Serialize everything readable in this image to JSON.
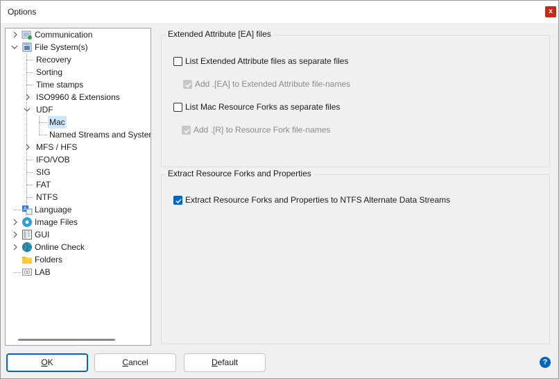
{
  "window": {
    "title": "Options",
    "close_glyph": "x"
  },
  "tree": {
    "items": [
      {
        "label": "Communication",
        "icon": "communication-icon",
        "expandable": true,
        "expanded": false
      },
      {
        "label": "File System(s)",
        "icon": "file-system-icon",
        "expandable": true,
        "expanded": true
      },
      {
        "label": "Recovery"
      },
      {
        "label": "Sorting"
      },
      {
        "label": "Time stamps"
      },
      {
        "label": "ISO9960 & Extensions",
        "expandable": true,
        "expanded": false
      },
      {
        "label": "UDF",
        "expandable": true,
        "expanded": true
      },
      {
        "label": "Mac",
        "selected": true
      },
      {
        "label": "Named Streams and Systems"
      },
      {
        "label": "MFS / HFS",
        "expandable": true,
        "expanded": false
      },
      {
        "label": "IFO/VOB"
      },
      {
        "label": "SIG"
      },
      {
        "label": "FAT"
      },
      {
        "label": "NTFS"
      },
      {
        "label": "Language",
        "icon": "language-icon"
      },
      {
        "label": "Image Files",
        "icon": "image-files-icon",
        "expandable": true,
        "expanded": false
      },
      {
        "label": "GUI",
        "icon": "gui-icon",
        "expandable": true,
        "expanded": false
      },
      {
        "label": "Online Check",
        "icon": "globe-icon",
        "expandable": true,
        "expanded": false
      },
      {
        "label": "Folders",
        "icon": "folder-icon"
      },
      {
        "label": "LAB",
        "icon": "lab-icon"
      }
    ]
  },
  "groups": {
    "ea": {
      "title": "Extended Attribute [EA] files",
      "list_ea": {
        "label": "List Extended Attribute files as separate files",
        "checked": false
      },
      "add_ea": {
        "label": "Add .[EA] to Extended Attribute file-names",
        "checked": true,
        "disabled": true
      },
      "list_forks": {
        "label": "List Mac Resource Forks as separate files",
        "checked": false
      },
      "add_r": {
        "label": "Add .[R] to Resource Fork file-names",
        "checked": true,
        "disabled": true
      }
    },
    "extract": {
      "title": "Extract Resource Forks and Properties",
      "extract_ntfs": {
        "label": "Extract Resource Forks and Properties to NTFS Alternate Data Streams",
        "checked": true
      }
    }
  },
  "buttons": {
    "ok": {
      "accel": "O",
      "rest": "K"
    },
    "cancel": {
      "accel": "C",
      "rest": "ancel"
    },
    "default": {
      "accel": "D",
      "rest": "efault"
    },
    "help_glyph": "?"
  },
  "colors": {
    "accent": "#0067c0",
    "close": "#c42b1c",
    "selection": "#cce8ff"
  }
}
